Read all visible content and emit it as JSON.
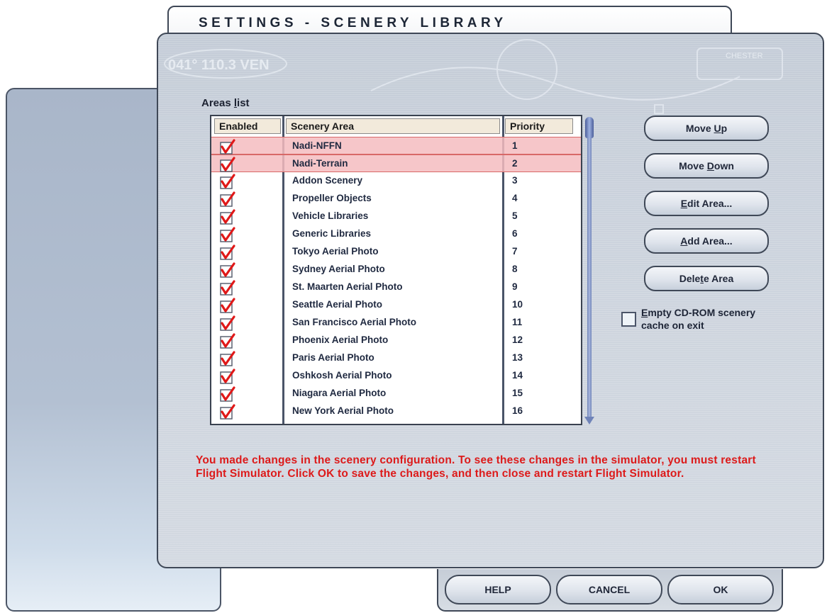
{
  "window": {
    "title": "SETTINGS - SCENERY LIBRARY"
  },
  "areas_list": {
    "label_prefix": "Areas ",
    "label_accel": "l",
    "label_suffix": "ist",
    "columns": [
      "Enabled",
      "Scenery Area",
      "Priority"
    ],
    "rows": [
      {
        "enabled": true,
        "name": "Nadi-NFFN",
        "priority": "1",
        "selected": true
      },
      {
        "enabled": true,
        "name": "Nadi-Terrain",
        "priority": "2",
        "selected": true
      },
      {
        "enabled": true,
        "name": "Addon Scenery",
        "priority": "3",
        "selected": false
      },
      {
        "enabled": true,
        "name": "Propeller Objects",
        "priority": "4",
        "selected": false
      },
      {
        "enabled": true,
        "name": "Vehicle Libraries",
        "priority": "5",
        "selected": false
      },
      {
        "enabled": true,
        "name": "Generic Libraries",
        "priority": "6",
        "selected": false
      },
      {
        "enabled": true,
        "name": "Tokyo Aerial Photo",
        "priority": "7",
        "selected": false
      },
      {
        "enabled": true,
        "name": "Sydney Aerial Photo",
        "priority": "8",
        "selected": false
      },
      {
        "enabled": true,
        "name": "St. Maarten Aerial Photo",
        "priority": "9",
        "selected": false
      },
      {
        "enabled": true,
        "name": "Seattle Aerial Photo",
        "priority": "10",
        "selected": false
      },
      {
        "enabled": true,
        "name": "San Francisco Aerial Photo",
        "priority": "11",
        "selected": false
      },
      {
        "enabled": true,
        "name": "Phoenix Aerial Photo",
        "priority": "12",
        "selected": false
      },
      {
        "enabled": true,
        "name": "Paris Aerial Photo",
        "priority": "13",
        "selected": false
      },
      {
        "enabled": true,
        "name": "Oshkosh Aerial Photo",
        "priority": "14",
        "selected": false
      },
      {
        "enabled": true,
        "name": "Niagara Aerial Photo",
        "priority": "15",
        "selected": false
      },
      {
        "enabled": true,
        "name": "New York Aerial Photo",
        "priority": "16",
        "selected": false
      }
    ]
  },
  "buttons": {
    "move_up": {
      "pre": "Move ",
      "accel": "U",
      "post": "p"
    },
    "move_down": {
      "pre": "Move ",
      "accel": "D",
      "post": "own"
    },
    "edit_area": {
      "pre": "",
      "accel": "E",
      "post": "dit Area..."
    },
    "add_area": {
      "pre": "",
      "accel": "A",
      "post": "dd Area..."
    },
    "delete_area": {
      "pre": "Dele",
      "accel": "t",
      "post": "e Area"
    }
  },
  "empty_cache": {
    "checked": false,
    "accel": "E",
    "label_post": "mpty CD-ROM scenery",
    "label_line2": "cache on exit"
  },
  "warning": "You made changes in the scenery configuration. To see these changes in the simulator, you must restart Flight Simulator. Click OK to save the changes, and then close and restart Flight Simulator.",
  "watermark": {
    "text1": "041° 110.3 VEN",
    "text2": "CHESTER"
  },
  "footer": {
    "help": "HELP",
    "cancel": "CANCEL",
    "ok": "OK"
  },
  "colors": {
    "warning": "#dd1a1a",
    "selection": "#f5bcc0",
    "check": "#e01818"
  }
}
